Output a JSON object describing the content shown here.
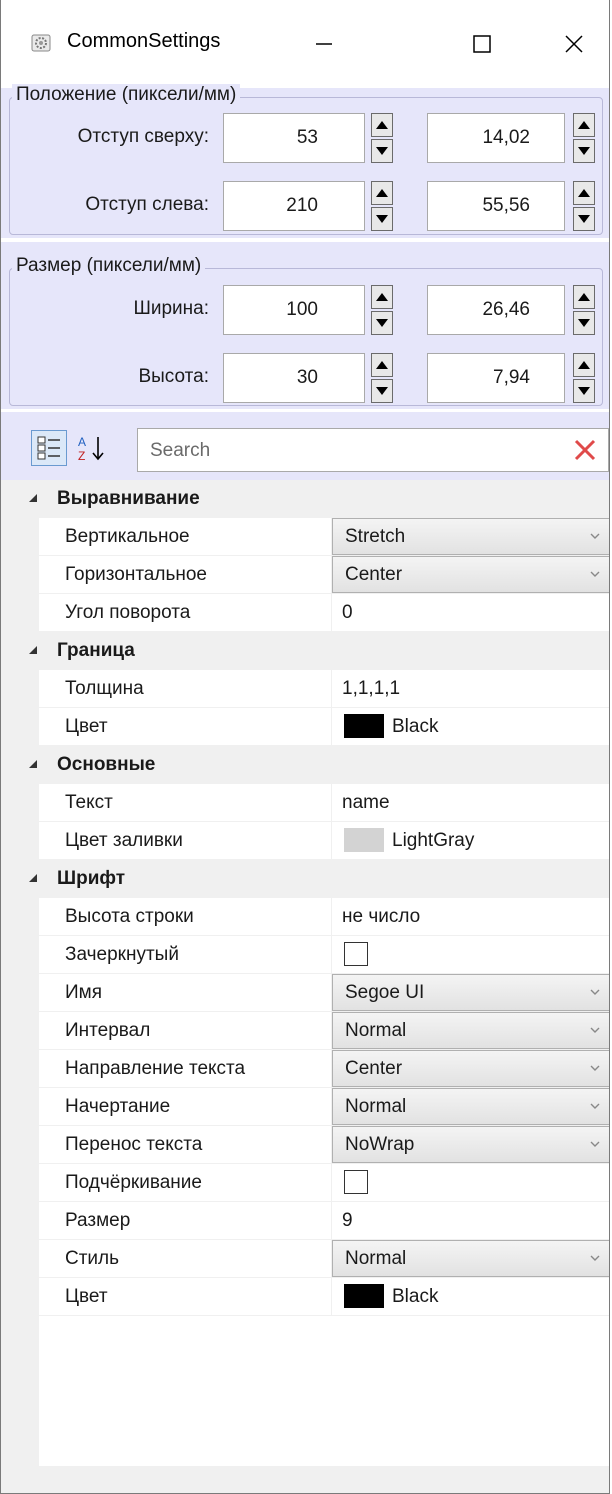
{
  "window": {
    "title": "CommonSettings"
  },
  "position": {
    "label": "Положение (пиксели/мм)",
    "top": {
      "label": "Отступ сверху:",
      "px": "53",
      "mm": "14,02"
    },
    "left": {
      "label": "Отступ слева:",
      "px": "210",
      "mm": "55,56"
    }
  },
  "size": {
    "label": "Размер (пиксели/мм)",
    "width": {
      "label": "Ширина:",
      "px": "100",
      "mm": "26,46"
    },
    "height": {
      "label": "Высота:",
      "px": "30",
      "mm": "7,94"
    }
  },
  "search": {
    "placeholder": "Search"
  },
  "categories": [
    {
      "name": "Выравнивание"
    },
    {
      "name": "Граница"
    },
    {
      "name": "Основные"
    },
    {
      "name": "Шрифт"
    }
  ],
  "props": {
    "vertical": {
      "name": "Вертикальное",
      "value": "Stretch"
    },
    "horizontal": {
      "name": "Горизонтальное",
      "value": "Center"
    },
    "rotation": {
      "name": "Угол поворота",
      "value": "0"
    },
    "thickness": {
      "name": "Толщина",
      "value": "1,1,1,1"
    },
    "border_color": {
      "name": "Цвет",
      "value": "Black",
      "color": "#000000"
    },
    "text": {
      "name": "Текст",
      "value": "name"
    },
    "fill": {
      "name": "Цвет заливки",
      "value": "LightGray",
      "color": "#d3d3d3"
    },
    "line_height": {
      "name": "Высота строки",
      "value": "не число"
    },
    "strikethrough": {
      "name": "Зачеркнутый",
      "checked": false
    },
    "font_name": {
      "name": "Имя",
      "value": "Segoe UI"
    },
    "spacing": {
      "name": "Интервал",
      "value": "Normal"
    },
    "text_direction": {
      "name": "Направление текста",
      "value": "Center"
    },
    "weight": {
      "name": "Начертание",
      "value": "Normal"
    },
    "wrap": {
      "name": "Перенос текста",
      "value": "NoWrap"
    },
    "underline": {
      "name": "Подчёркивание",
      "checked": false
    },
    "font_size": {
      "name": "Размер",
      "value": "9"
    },
    "style": {
      "name": "Стиль",
      "value": "Normal"
    },
    "font_color": {
      "name": "Цвет",
      "value": "Black",
      "color": "#000000"
    }
  }
}
